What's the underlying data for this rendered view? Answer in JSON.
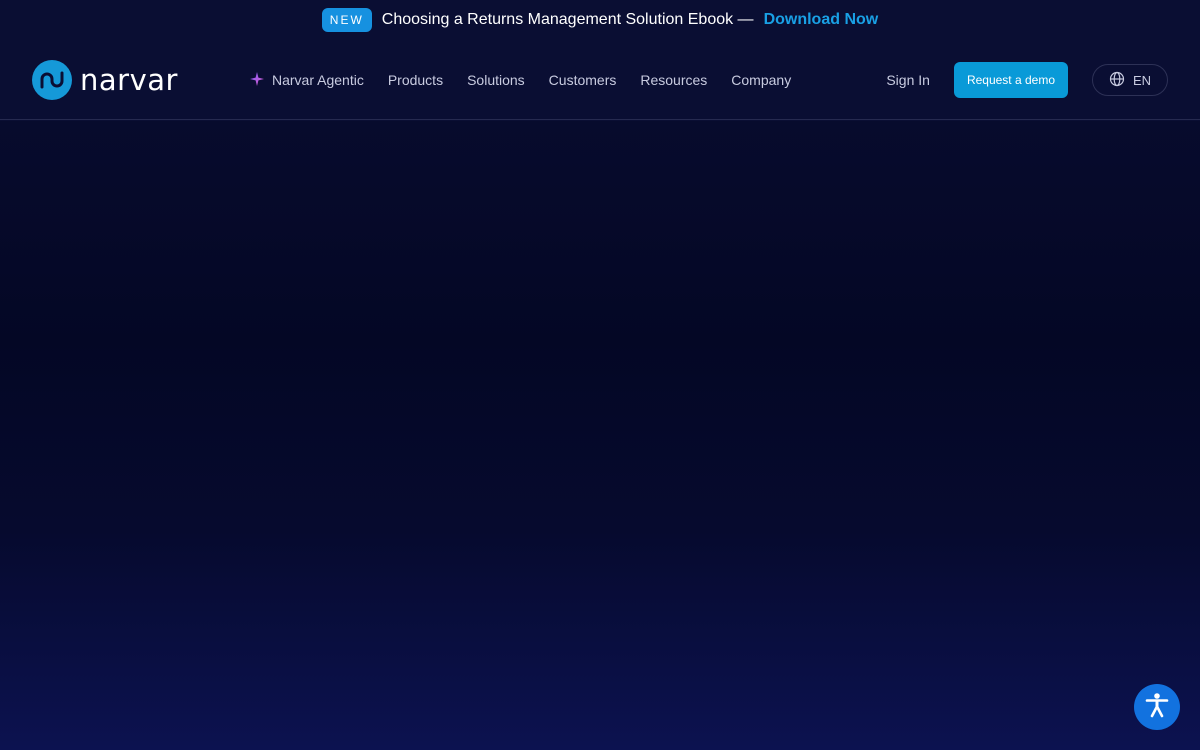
{
  "announcement": {
    "badge": "NEW",
    "text": "Choosing a Returns Management Solution Ebook —",
    "link": "Download Now"
  },
  "brand": {
    "name": "narvar",
    "accent": "#1599d8"
  },
  "nav": {
    "items": [
      {
        "label": "Narvar Agentic",
        "icon": "sparkle-icon"
      },
      {
        "label": "Products"
      },
      {
        "label": "Solutions"
      },
      {
        "label": "Customers"
      },
      {
        "label": "Resources"
      },
      {
        "label": "Company"
      }
    ]
  },
  "header": {
    "sign_in": "Sign In",
    "demo_button": "Request a demo",
    "language": "EN"
  },
  "colors": {
    "background": "#0a0e33",
    "primary_button": "#099ad8",
    "link": "#19a0e5",
    "accessibility": "#1272df"
  }
}
